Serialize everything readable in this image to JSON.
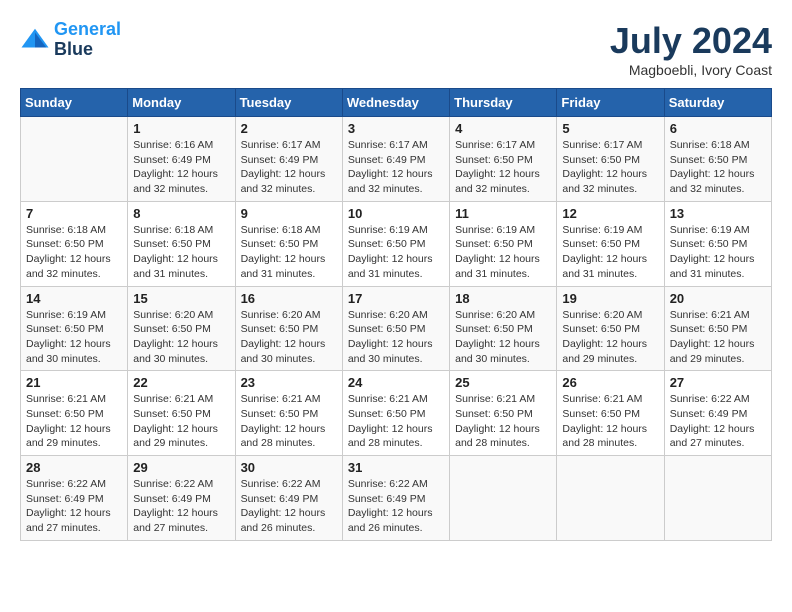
{
  "header": {
    "logo_line1": "General",
    "logo_line2": "Blue",
    "month_year": "July 2024",
    "location": "Magboebli, Ivory Coast"
  },
  "days_of_week": [
    "Sunday",
    "Monday",
    "Tuesday",
    "Wednesday",
    "Thursday",
    "Friday",
    "Saturday"
  ],
  "weeks": [
    [
      {
        "day": "",
        "info": ""
      },
      {
        "day": "1",
        "info": "Sunrise: 6:16 AM\nSunset: 6:49 PM\nDaylight: 12 hours\nand 32 minutes."
      },
      {
        "day": "2",
        "info": "Sunrise: 6:17 AM\nSunset: 6:49 PM\nDaylight: 12 hours\nand 32 minutes."
      },
      {
        "day": "3",
        "info": "Sunrise: 6:17 AM\nSunset: 6:49 PM\nDaylight: 12 hours\nand 32 minutes."
      },
      {
        "day": "4",
        "info": "Sunrise: 6:17 AM\nSunset: 6:50 PM\nDaylight: 12 hours\nand 32 minutes."
      },
      {
        "day": "5",
        "info": "Sunrise: 6:17 AM\nSunset: 6:50 PM\nDaylight: 12 hours\nand 32 minutes."
      },
      {
        "day": "6",
        "info": "Sunrise: 6:18 AM\nSunset: 6:50 PM\nDaylight: 12 hours\nand 32 minutes."
      }
    ],
    [
      {
        "day": "7",
        "info": "Sunrise: 6:18 AM\nSunset: 6:50 PM\nDaylight: 12 hours\nand 32 minutes."
      },
      {
        "day": "8",
        "info": "Sunrise: 6:18 AM\nSunset: 6:50 PM\nDaylight: 12 hours\nand 31 minutes."
      },
      {
        "day": "9",
        "info": "Sunrise: 6:18 AM\nSunset: 6:50 PM\nDaylight: 12 hours\nand 31 minutes."
      },
      {
        "day": "10",
        "info": "Sunrise: 6:19 AM\nSunset: 6:50 PM\nDaylight: 12 hours\nand 31 minutes."
      },
      {
        "day": "11",
        "info": "Sunrise: 6:19 AM\nSunset: 6:50 PM\nDaylight: 12 hours\nand 31 minutes."
      },
      {
        "day": "12",
        "info": "Sunrise: 6:19 AM\nSunset: 6:50 PM\nDaylight: 12 hours\nand 31 minutes."
      },
      {
        "day": "13",
        "info": "Sunrise: 6:19 AM\nSunset: 6:50 PM\nDaylight: 12 hours\nand 31 minutes."
      }
    ],
    [
      {
        "day": "14",
        "info": "Sunrise: 6:19 AM\nSunset: 6:50 PM\nDaylight: 12 hours\nand 30 minutes."
      },
      {
        "day": "15",
        "info": "Sunrise: 6:20 AM\nSunset: 6:50 PM\nDaylight: 12 hours\nand 30 minutes."
      },
      {
        "day": "16",
        "info": "Sunrise: 6:20 AM\nSunset: 6:50 PM\nDaylight: 12 hours\nand 30 minutes."
      },
      {
        "day": "17",
        "info": "Sunrise: 6:20 AM\nSunset: 6:50 PM\nDaylight: 12 hours\nand 30 minutes."
      },
      {
        "day": "18",
        "info": "Sunrise: 6:20 AM\nSunset: 6:50 PM\nDaylight: 12 hours\nand 30 minutes."
      },
      {
        "day": "19",
        "info": "Sunrise: 6:20 AM\nSunset: 6:50 PM\nDaylight: 12 hours\nand 29 minutes."
      },
      {
        "day": "20",
        "info": "Sunrise: 6:21 AM\nSunset: 6:50 PM\nDaylight: 12 hours\nand 29 minutes."
      }
    ],
    [
      {
        "day": "21",
        "info": "Sunrise: 6:21 AM\nSunset: 6:50 PM\nDaylight: 12 hours\nand 29 minutes."
      },
      {
        "day": "22",
        "info": "Sunrise: 6:21 AM\nSunset: 6:50 PM\nDaylight: 12 hours\nand 29 minutes."
      },
      {
        "day": "23",
        "info": "Sunrise: 6:21 AM\nSunset: 6:50 PM\nDaylight: 12 hours\nand 28 minutes."
      },
      {
        "day": "24",
        "info": "Sunrise: 6:21 AM\nSunset: 6:50 PM\nDaylight: 12 hours\nand 28 minutes."
      },
      {
        "day": "25",
        "info": "Sunrise: 6:21 AM\nSunset: 6:50 PM\nDaylight: 12 hours\nand 28 minutes."
      },
      {
        "day": "26",
        "info": "Sunrise: 6:21 AM\nSunset: 6:50 PM\nDaylight: 12 hours\nand 28 minutes."
      },
      {
        "day": "27",
        "info": "Sunrise: 6:22 AM\nSunset: 6:49 PM\nDaylight: 12 hours\nand 27 minutes."
      }
    ],
    [
      {
        "day": "28",
        "info": "Sunrise: 6:22 AM\nSunset: 6:49 PM\nDaylight: 12 hours\nand 27 minutes."
      },
      {
        "day": "29",
        "info": "Sunrise: 6:22 AM\nSunset: 6:49 PM\nDaylight: 12 hours\nand 27 minutes."
      },
      {
        "day": "30",
        "info": "Sunrise: 6:22 AM\nSunset: 6:49 PM\nDaylight: 12 hours\nand 26 minutes."
      },
      {
        "day": "31",
        "info": "Sunrise: 6:22 AM\nSunset: 6:49 PM\nDaylight: 12 hours\nand 26 minutes."
      },
      {
        "day": "",
        "info": ""
      },
      {
        "day": "",
        "info": ""
      },
      {
        "day": "",
        "info": ""
      }
    ]
  ]
}
